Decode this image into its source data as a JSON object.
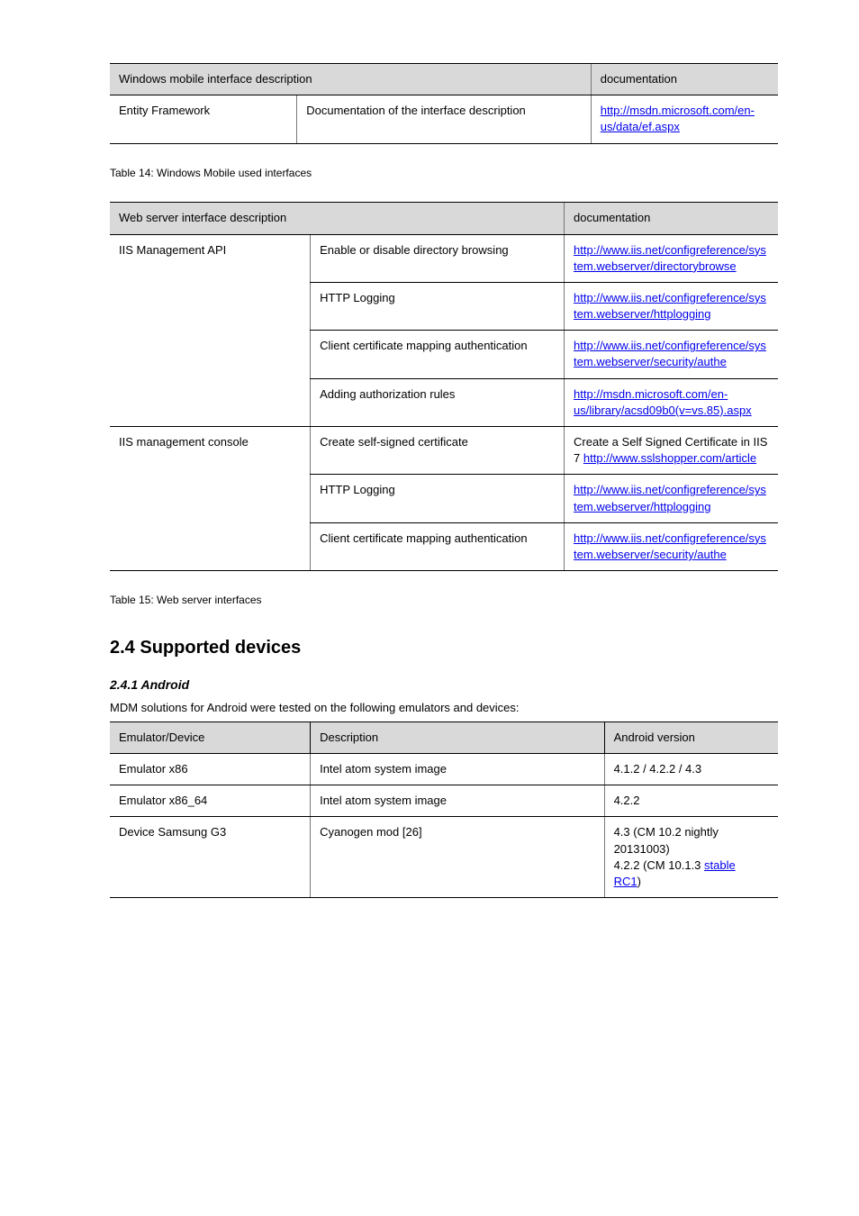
{
  "table14": {
    "headers": {
      "left": "Windows mobile interface description",
      "right": "documentation"
    },
    "row": {
      "left": "Entity Framework",
      "mid": "Documentation of the interface description",
      "right_link": "http://msdn.microsoft.com/en-us/data/ef.aspx"
    },
    "caption": "Table 14: Windows Mobile used interfaces"
  },
  "table15": {
    "headers": {
      "left": "Web server interface description",
      "right": "documentation"
    },
    "rows": [
      {
        "left": "IIS Management API",
        "mid": "Enable or disable directory browsing",
        "right_text": "",
        "right_links": [
          "http://www.iis.net/configreference/system.webserver/directorybrowse"
        ]
      },
      {
        "left": "",
        "mid": "HTTP Logging",
        "right_links": [
          "http://www.iis.net/configreference/system.webserver/httplogging"
        ]
      },
      {
        "left": "",
        "mid": "Client certificate mapping authentication",
        "right_links": [
          "http://www.iis.net/configreference/system.webserver/security/authe"
        ]
      },
      {
        "left": "",
        "mid": "Adding authorization rules",
        "right_links": [
          "http://msdn.microsoft.com/en-",
          "us/library/acsd09b0(v=vs.85).aspx"
        ]
      },
      {
        "left": "IIS management console",
        "mid": "Create self-signed certificate",
        "right_text": "Create a Self Signed Certificate in IIS 7 ",
        "right_links": [
          "http://www.sslshopper.com/article"
        ]
      },
      {
        "left": "",
        "mid": "HTTP Logging",
        "right_links": [
          "http://www.iis.net/configreference/system.webserver/httplogging"
        ]
      },
      {
        "left": "",
        "mid": "Client certificate mapping authentication",
        "right_links": [
          "http://www.iis.net/configreference/system.webserver/security/authe"
        ]
      }
    ],
    "caption": "Table 15: Web server interfaces"
  },
  "section": {
    "heading2": "2.4 Supported devices",
    "heading3": "2.4.1 Android",
    "body": "MDM solutions for Android were tested on the following emulators and devices:"
  },
  "table16": {
    "headers": {
      "c1": "Emulator/Device",
      "c2": "Description",
      "c3": "Android version"
    },
    "rows": [
      {
        "c1": "Emulator x86",
        "c2": "Intel atom system image",
        "c3": "4.1.2 / 4.2.2 / 4.3"
      },
      {
        "c1": "Emulator x86_64",
        "c2": "Intel atom system image",
        "c3": "4.2.2"
      },
      {
        "c1": "Device Samsung G3",
        "c2": "Cyanogen mod [26]",
        "c3_multiline": [
          "4.3 (CM 10.2 nightly 20131003)",
          {
            "text": "4.2.2 (CM 10.1.3 ",
            "link_text": "stable",
            "link_url": "#"
          },
          {
            "link_text": "RC1",
            "link_url": "#",
            "suffix": ")"
          }
        ]
      }
    ]
  }
}
